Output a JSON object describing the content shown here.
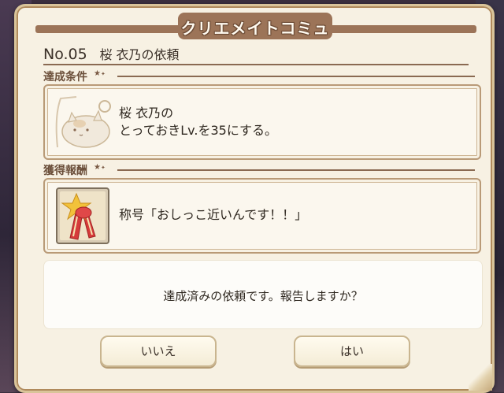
{
  "dialog": {
    "title": "クリエメイトコミュ",
    "request_no": "No.05",
    "request_name": "桜 衣乃の依頼"
  },
  "condition": {
    "label": "達成条件",
    "line1": "桜 衣乃の",
    "line2": "とっておきLv.を35にする。"
  },
  "reward": {
    "label": "獲得報酬",
    "text": "称号「おしっこ近いんです！！」"
  },
  "message": "達成済みの依頼です。報告しますか？",
  "buttons": {
    "no_label": "いいえ",
    "yes_label": "はい"
  },
  "colors": {
    "panel_bg": "#f7f1e3",
    "accent_brown": "#9c7458",
    "text": "#2f2820"
  }
}
